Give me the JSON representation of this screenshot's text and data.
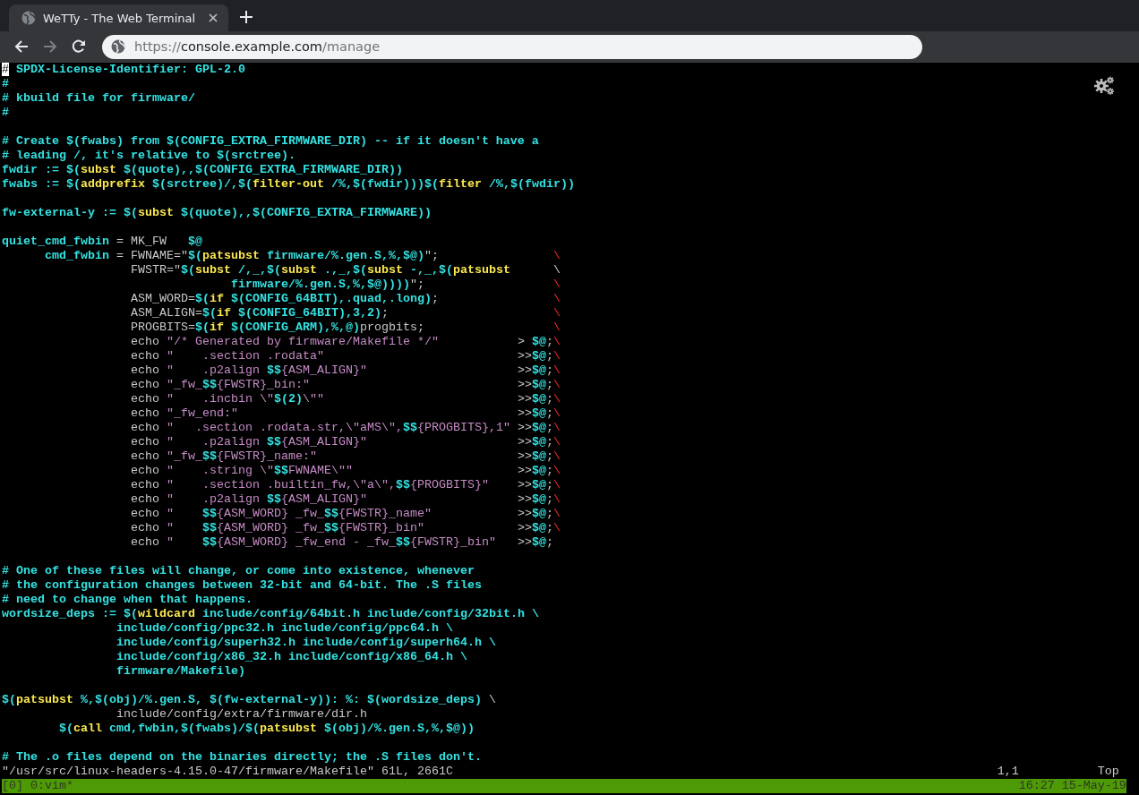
{
  "browser": {
    "tabs": [
      {
        "title": "WeTTy - The Web Terminal",
        "selected": true
      }
    ],
    "nav_buttons": [
      {
        "kind": "back",
        "disabled": false
      },
      {
        "kind": "forward",
        "disabled": true
      },
      {
        "kind": "reload",
        "disabled": false
      }
    ],
    "url": {
      "scheme": "https://",
      "host": "console.example.com",
      "path": "/manage"
    }
  },
  "editor": {
    "lines": [
      {
        "kind": "code",
        "segments": [
          {
            "kind": "cursor",
            "text": "#"
          },
          {
            "kind": "comment",
            "text": " SPDX-License-Identifier: GPL-2.0"
          }
        ]
      },
      {
        "kind": "code",
        "segments": [
          {
            "kind": "comment",
            "text": "#"
          }
        ]
      },
      {
        "kind": "code",
        "segments": [
          {
            "kind": "comment",
            "text": "# kbuild file for firmware/"
          }
        ]
      },
      {
        "kind": "code",
        "segments": [
          {
            "kind": "comment",
            "text": "#"
          }
        ]
      },
      {
        "kind": "blank"
      },
      {
        "kind": "code",
        "segments": [
          {
            "kind": "comment",
            "text": "# Create $(fwabs) from $(CONFIG_EXTRA_FIRMWARE_DIR) -- if it doesn't have a"
          }
        ]
      },
      {
        "kind": "code",
        "segments": [
          {
            "kind": "comment",
            "text": "# leading /, it's relative to $(srctree)."
          }
        ]
      },
      {
        "kind": "code",
        "segments": [
          {
            "kind": "ident",
            "text": "fwdir := $("
          },
          {
            "kind": "func",
            "text": "subst"
          },
          {
            "kind": "ident",
            "text": " $(quote),,$(CONFIG_EXTRA_FIRMWARE_DIR))"
          }
        ]
      },
      {
        "kind": "code",
        "segments": [
          {
            "kind": "ident",
            "text": "fwabs := $("
          },
          {
            "kind": "func",
            "text": "addprefix"
          },
          {
            "kind": "ident",
            "text": " $(srctree)/,$("
          },
          {
            "kind": "func",
            "text": "filter-out"
          },
          {
            "kind": "ident",
            "text": " /%,$(fwdir)))$("
          },
          {
            "kind": "func",
            "text": "filter"
          },
          {
            "kind": "ident",
            "text": " /%,$(fwdir))"
          }
        ]
      },
      {
        "kind": "blank"
      },
      {
        "kind": "code",
        "segments": [
          {
            "kind": "ident",
            "text": "fw-external-y := $("
          },
          {
            "kind": "func",
            "text": "subst"
          },
          {
            "kind": "ident",
            "text": " $(quote),,$(CONFIG_EXTRA_FIRMWARE))"
          }
        ]
      },
      {
        "kind": "blank"
      },
      {
        "kind": "code",
        "segments": [
          {
            "kind": "ident",
            "text": "quiet_cmd_fwbin"
          },
          {
            "kind": "plain",
            "text": " = MK_FW   "
          },
          {
            "kind": "ident",
            "text": "$@"
          }
        ]
      },
      {
        "kind": "code",
        "segments": [
          {
            "kind": "ident",
            "text": "      cmd_fwbin"
          },
          {
            "kind": "plain",
            "text": " = FWNAME=\""
          },
          {
            "kind": "ident",
            "text": "$("
          },
          {
            "kind": "func",
            "text": "patsubst"
          },
          {
            "kind": "ident",
            "text": " firmware/%.gen.S,%,$@)"
          },
          {
            "kind": "plain",
            "text": "\";                "
          },
          {
            "kind": "cont",
            "text": "\\"
          }
        ]
      },
      {
        "kind": "code",
        "segments": [
          {
            "kind": "plain",
            "text": "                  FWSTR=\""
          },
          {
            "kind": "ident",
            "text": "$("
          },
          {
            "kind": "func",
            "text": "subst"
          },
          {
            "kind": "ident",
            "text": " /,_,$("
          },
          {
            "kind": "func",
            "text": "subst"
          },
          {
            "kind": "ident",
            "text": " .,_,$("
          },
          {
            "kind": "func",
            "text": "subst"
          },
          {
            "kind": "ident",
            "text": " -,_,$("
          },
          {
            "kind": "func",
            "text": "patsubst"
          },
          {
            "kind": "plain",
            "text": "      \\"
          }
        ]
      },
      {
        "kind": "code",
        "segments": [
          {
            "kind": "ident",
            "text": "                                firmware/%.gen.S,%,$@))))"
          },
          {
            "kind": "plain",
            "text": "\";                  "
          },
          {
            "kind": "cont",
            "text": "\\"
          }
        ]
      },
      {
        "kind": "code",
        "segments": [
          {
            "kind": "plain",
            "text": "                  ASM_WORD="
          },
          {
            "kind": "ident",
            "text": "$("
          },
          {
            "kind": "func",
            "text": "if"
          },
          {
            "kind": "ident",
            "text": " $(CONFIG_64BIT),.quad,.long)"
          },
          {
            "kind": "plain",
            "text": ";                "
          },
          {
            "kind": "cont",
            "text": "\\"
          }
        ]
      },
      {
        "kind": "code",
        "segments": [
          {
            "kind": "plain",
            "text": "                  ASM_ALIGN="
          },
          {
            "kind": "ident",
            "text": "$("
          },
          {
            "kind": "func",
            "text": "if"
          },
          {
            "kind": "ident",
            "text": " $(CONFIG_64BIT),3,2)"
          },
          {
            "kind": "plain",
            "text": ";                       "
          },
          {
            "kind": "cont",
            "text": "\\"
          }
        ]
      },
      {
        "kind": "code",
        "segments": [
          {
            "kind": "plain",
            "text": "                  PROGBITS="
          },
          {
            "kind": "ident",
            "text": "$("
          },
          {
            "kind": "func",
            "text": "if"
          },
          {
            "kind": "ident",
            "text": " $(CONFIG_ARM),%,@)"
          },
          {
            "kind": "plain",
            "text": "progbits;                  "
          },
          {
            "kind": "cont",
            "text": "\\"
          }
        ]
      },
      {
        "kind": "code",
        "segments": [
          {
            "kind": "plain",
            "text": "                  echo "
          },
          {
            "kind": "string",
            "text": "\"/* Generated by firmware/Makefile */\""
          },
          {
            "kind": "plain",
            "text": "           > "
          },
          {
            "kind": "ident",
            "text": "$@"
          },
          {
            "kind": "plain",
            "text": ";"
          },
          {
            "kind": "cont",
            "text": "\\"
          }
        ]
      },
      {
        "kind": "code",
        "segments": [
          {
            "kind": "plain",
            "text": "                  echo "
          },
          {
            "kind": "string",
            "text": "\"    .section .rodata\""
          },
          {
            "kind": "plain",
            "text": "                           >>"
          },
          {
            "kind": "ident",
            "text": "$@"
          },
          {
            "kind": "plain",
            "text": ";"
          },
          {
            "kind": "cont",
            "text": "\\"
          }
        ]
      },
      {
        "kind": "code",
        "segments": [
          {
            "kind": "plain",
            "text": "                  echo "
          },
          {
            "kind": "string",
            "text": "\"    .p2align "
          },
          {
            "kind": "ident",
            "text": "$$"
          },
          {
            "kind": "string",
            "text": "{ASM_ALIGN}\""
          },
          {
            "kind": "plain",
            "text": "                     >>"
          },
          {
            "kind": "ident",
            "text": "$@"
          },
          {
            "kind": "plain",
            "text": ";"
          },
          {
            "kind": "cont",
            "text": "\\"
          }
        ]
      },
      {
        "kind": "code",
        "segments": [
          {
            "kind": "plain",
            "text": "                  echo "
          },
          {
            "kind": "string",
            "text": "\"_fw_"
          },
          {
            "kind": "ident",
            "text": "$$"
          },
          {
            "kind": "string",
            "text": "{FWSTR}_bin:\""
          },
          {
            "kind": "plain",
            "text": "                             >>"
          },
          {
            "kind": "ident",
            "text": "$@"
          },
          {
            "kind": "plain",
            "text": ";"
          },
          {
            "kind": "cont",
            "text": "\\"
          }
        ]
      },
      {
        "kind": "code",
        "segments": [
          {
            "kind": "plain",
            "text": "                  echo "
          },
          {
            "kind": "string",
            "text": "\"    .incbin \\\""
          },
          {
            "kind": "ident",
            "text": "$(2)"
          },
          {
            "kind": "string",
            "text": "\\\"\""
          },
          {
            "kind": "plain",
            "text": "                           >>"
          },
          {
            "kind": "ident",
            "text": "$@"
          },
          {
            "kind": "plain",
            "text": ";"
          },
          {
            "kind": "cont",
            "text": "\\"
          }
        ]
      },
      {
        "kind": "code",
        "segments": [
          {
            "kind": "plain",
            "text": "                  echo "
          },
          {
            "kind": "string",
            "text": "\"_fw_end:\""
          },
          {
            "kind": "plain",
            "text": "                                       >>"
          },
          {
            "kind": "ident",
            "text": "$@"
          },
          {
            "kind": "plain",
            "text": ";"
          },
          {
            "kind": "cont",
            "text": "\\"
          }
        ]
      },
      {
        "kind": "code",
        "segments": [
          {
            "kind": "plain",
            "text": "                  echo "
          },
          {
            "kind": "string",
            "text": "\"   .section .rodata.str,\\\"aMS\\\","
          },
          {
            "kind": "ident",
            "text": "$$"
          },
          {
            "kind": "string",
            "text": "{PROGBITS},1\""
          },
          {
            "kind": "plain",
            "text": " >>"
          },
          {
            "kind": "ident",
            "text": "$@"
          },
          {
            "kind": "plain",
            "text": ";"
          },
          {
            "kind": "cont",
            "text": "\\"
          }
        ]
      },
      {
        "kind": "code",
        "segments": [
          {
            "kind": "plain",
            "text": "                  echo "
          },
          {
            "kind": "string",
            "text": "\"    .p2align "
          },
          {
            "kind": "ident",
            "text": "$$"
          },
          {
            "kind": "string",
            "text": "{ASM_ALIGN}\""
          },
          {
            "kind": "plain",
            "text": "                     >>"
          },
          {
            "kind": "ident",
            "text": "$@"
          },
          {
            "kind": "plain",
            "text": ";"
          },
          {
            "kind": "cont",
            "text": "\\"
          }
        ]
      },
      {
        "kind": "code",
        "segments": [
          {
            "kind": "plain",
            "text": "                  echo "
          },
          {
            "kind": "string",
            "text": "\"_fw_"
          },
          {
            "kind": "ident",
            "text": "$$"
          },
          {
            "kind": "string",
            "text": "{FWSTR}_name:\""
          },
          {
            "kind": "plain",
            "text": "                            >>"
          },
          {
            "kind": "ident",
            "text": "$@"
          },
          {
            "kind": "plain",
            "text": ";"
          },
          {
            "kind": "cont",
            "text": "\\"
          }
        ]
      },
      {
        "kind": "code",
        "segments": [
          {
            "kind": "plain",
            "text": "                  echo "
          },
          {
            "kind": "string",
            "text": "\"    .string \\\""
          },
          {
            "kind": "ident",
            "text": "$$"
          },
          {
            "kind": "string",
            "text": "FWNAME\\\"\""
          },
          {
            "kind": "plain",
            "text": "                       >>"
          },
          {
            "kind": "ident",
            "text": "$@"
          },
          {
            "kind": "plain",
            "text": ";"
          },
          {
            "kind": "cont",
            "text": "\\"
          }
        ]
      },
      {
        "kind": "code",
        "segments": [
          {
            "kind": "plain",
            "text": "                  echo "
          },
          {
            "kind": "string",
            "text": "\"    .section .builtin_fw,\\\"a\\\","
          },
          {
            "kind": "ident",
            "text": "$$"
          },
          {
            "kind": "string",
            "text": "{PROGBITS}\""
          },
          {
            "kind": "plain",
            "text": "    >>"
          },
          {
            "kind": "ident",
            "text": "$@"
          },
          {
            "kind": "plain",
            "text": ";"
          },
          {
            "kind": "cont",
            "text": "\\"
          }
        ]
      },
      {
        "kind": "code",
        "segments": [
          {
            "kind": "plain",
            "text": "                  echo "
          },
          {
            "kind": "string",
            "text": "\"    .p2align "
          },
          {
            "kind": "ident",
            "text": "$$"
          },
          {
            "kind": "string",
            "text": "{ASM_ALIGN}\""
          },
          {
            "kind": "plain",
            "text": "                     >>"
          },
          {
            "kind": "ident",
            "text": "$@"
          },
          {
            "kind": "plain",
            "text": ";"
          },
          {
            "kind": "cont",
            "text": "\\"
          }
        ]
      },
      {
        "kind": "code",
        "segments": [
          {
            "kind": "plain",
            "text": "                  echo "
          },
          {
            "kind": "string",
            "text": "\"    "
          },
          {
            "kind": "ident",
            "text": "$$"
          },
          {
            "kind": "string",
            "text": "{ASM_WORD} _fw_"
          },
          {
            "kind": "ident",
            "text": "$$"
          },
          {
            "kind": "string",
            "text": "{FWSTR}_name\""
          },
          {
            "kind": "plain",
            "text": "            >>"
          },
          {
            "kind": "ident",
            "text": "$@"
          },
          {
            "kind": "plain",
            "text": ";"
          },
          {
            "kind": "cont",
            "text": "\\"
          }
        ]
      },
      {
        "kind": "code",
        "segments": [
          {
            "kind": "plain",
            "text": "                  echo "
          },
          {
            "kind": "string",
            "text": "\"    "
          },
          {
            "kind": "ident",
            "text": "$$"
          },
          {
            "kind": "string",
            "text": "{ASM_WORD} _fw_"
          },
          {
            "kind": "ident",
            "text": "$$"
          },
          {
            "kind": "string",
            "text": "{FWSTR}_bin\""
          },
          {
            "kind": "plain",
            "text": "             >>"
          },
          {
            "kind": "ident",
            "text": "$@"
          },
          {
            "kind": "plain",
            "text": ";"
          },
          {
            "kind": "cont",
            "text": "\\"
          }
        ]
      },
      {
        "kind": "code",
        "segments": [
          {
            "kind": "plain",
            "text": "                  echo "
          },
          {
            "kind": "string",
            "text": "\"    "
          },
          {
            "kind": "ident",
            "text": "$$"
          },
          {
            "kind": "string",
            "text": "{ASM_WORD} _fw_end - _fw_"
          },
          {
            "kind": "ident",
            "text": "$$"
          },
          {
            "kind": "string",
            "text": "{FWSTR}_bin\""
          },
          {
            "kind": "plain",
            "text": "   >>"
          },
          {
            "kind": "ident",
            "text": "$@"
          },
          {
            "kind": "plain",
            "text": ";"
          }
        ]
      },
      {
        "kind": "blank"
      },
      {
        "kind": "code",
        "segments": [
          {
            "kind": "comment",
            "text": "# One of these files will change, or come into existence, whenever"
          }
        ]
      },
      {
        "kind": "code",
        "segments": [
          {
            "kind": "comment",
            "text": "# the configuration changes between 32-bit and 64-bit. The .S files"
          }
        ]
      },
      {
        "kind": "code",
        "segments": [
          {
            "kind": "comment",
            "text": "# need to change when that happens."
          }
        ]
      },
      {
        "kind": "code",
        "segments": [
          {
            "kind": "ident",
            "text": "wordsize_deps := $("
          },
          {
            "kind": "func",
            "text": "wildcard"
          },
          {
            "kind": "ident",
            "text": " include/config/64bit.h include/config/32bit.h \\"
          }
        ]
      },
      {
        "kind": "code",
        "segments": [
          {
            "kind": "ident",
            "text": "                include/config/ppc32.h include/config/ppc64.h \\"
          }
        ]
      },
      {
        "kind": "code",
        "segments": [
          {
            "kind": "ident",
            "text": "                include/config/superh32.h include/config/superh64.h \\"
          }
        ]
      },
      {
        "kind": "code",
        "segments": [
          {
            "kind": "ident",
            "text": "                include/config/x86_32.h include/config/x86_64.h \\"
          }
        ]
      },
      {
        "kind": "code",
        "segments": [
          {
            "kind": "ident",
            "text": "                firmware/Makefile)"
          }
        ]
      },
      {
        "kind": "blank"
      },
      {
        "kind": "code",
        "segments": [
          {
            "kind": "ident",
            "text": "$("
          },
          {
            "kind": "func",
            "text": "patsubst"
          },
          {
            "kind": "ident",
            "text": " %,$(obj)/%.gen.S, $(fw-external-y)): %: $(wordsize_deps)"
          },
          {
            "kind": "plain",
            "text": " \\"
          }
        ]
      },
      {
        "kind": "code",
        "segments": [
          {
            "kind": "plain",
            "text": "                include/config/extra/firmware/dir.h"
          }
        ]
      },
      {
        "kind": "code",
        "segments": [
          {
            "kind": "ident",
            "text": "        $("
          },
          {
            "kind": "func",
            "text": "call"
          },
          {
            "kind": "ident",
            "text": " cmd,fwbin,$(fwabs)/$("
          },
          {
            "kind": "func",
            "text": "patsubst"
          },
          {
            "kind": "ident",
            "text": " $(obj)/%.gen.S,%,$@))"
          }
        ]
      },
      {
        "kind": "blank"
      },
      {
        "kind": "code",
        "segments": [
          {
            "kind": "comment",
            "text": "# The .o files depend on the binaries directly; the .S files don't."
          }
        ]
      }
    ],
    "status": {
      "message": "\"/usr/src/linux-headers-4.15.0-47/firmware/Makefile\" 61L, 2661C",
      "ruler": "1,1",
      "scroll": "Top"
    }
  },
  "tmux": {
    "window_list": "[0] 0:vim*",
    "clock": "16:27 15-May-19"
  }
}
